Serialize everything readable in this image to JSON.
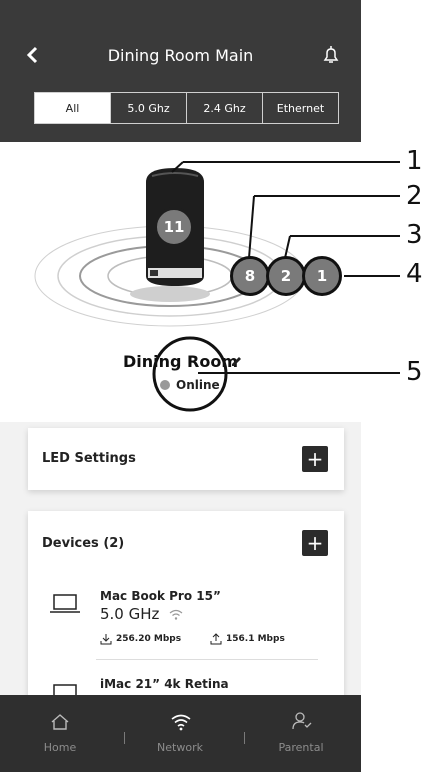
{
  "header": {
    "title": "Dining Room Main"
  },
  "tabs": [
    {
      "label": "All"
    },
    {
      "label": "5.0 Ghz"
    },
    {
      "label": "2.4 Ghz"
    },
    {
      "label": "Ethernet"
    }
  ],
  "router": {
    "badge_main": "11",
    "badges": [
      "8",
      "2",
      "1"
    ],
    "name": "Dining Room",
    "status": "Online"
  },
  "callouts": [
    "1",
    "2",
    "3",
    "4",
    "5"
  ],
  "led_card": {
    "title": "LED Settings",
    "plus": "+"
  },
  "devices_card": {
    "title": "Devices (2)",
    "plus": "+",
    "items": [
      {
        "name": "Mac Book Pro 15”",
        "band": "5.0 GHz",
        "down": "256.20 Mbps",
        "up": "156.1 Mbps"
      },
      {
        "name": "iMac 21” 4k Retina"
      }
    ]
  },
  "bottom_nav": [
    {
      "label": "Home",
      "icon": "home-icon"
    },
    {
      "label": "Network",
      "icon": "wifi-icon"
    },
    {
      "label": "Parental",
      "icon": "parental-icon"
    }
  ]
}
